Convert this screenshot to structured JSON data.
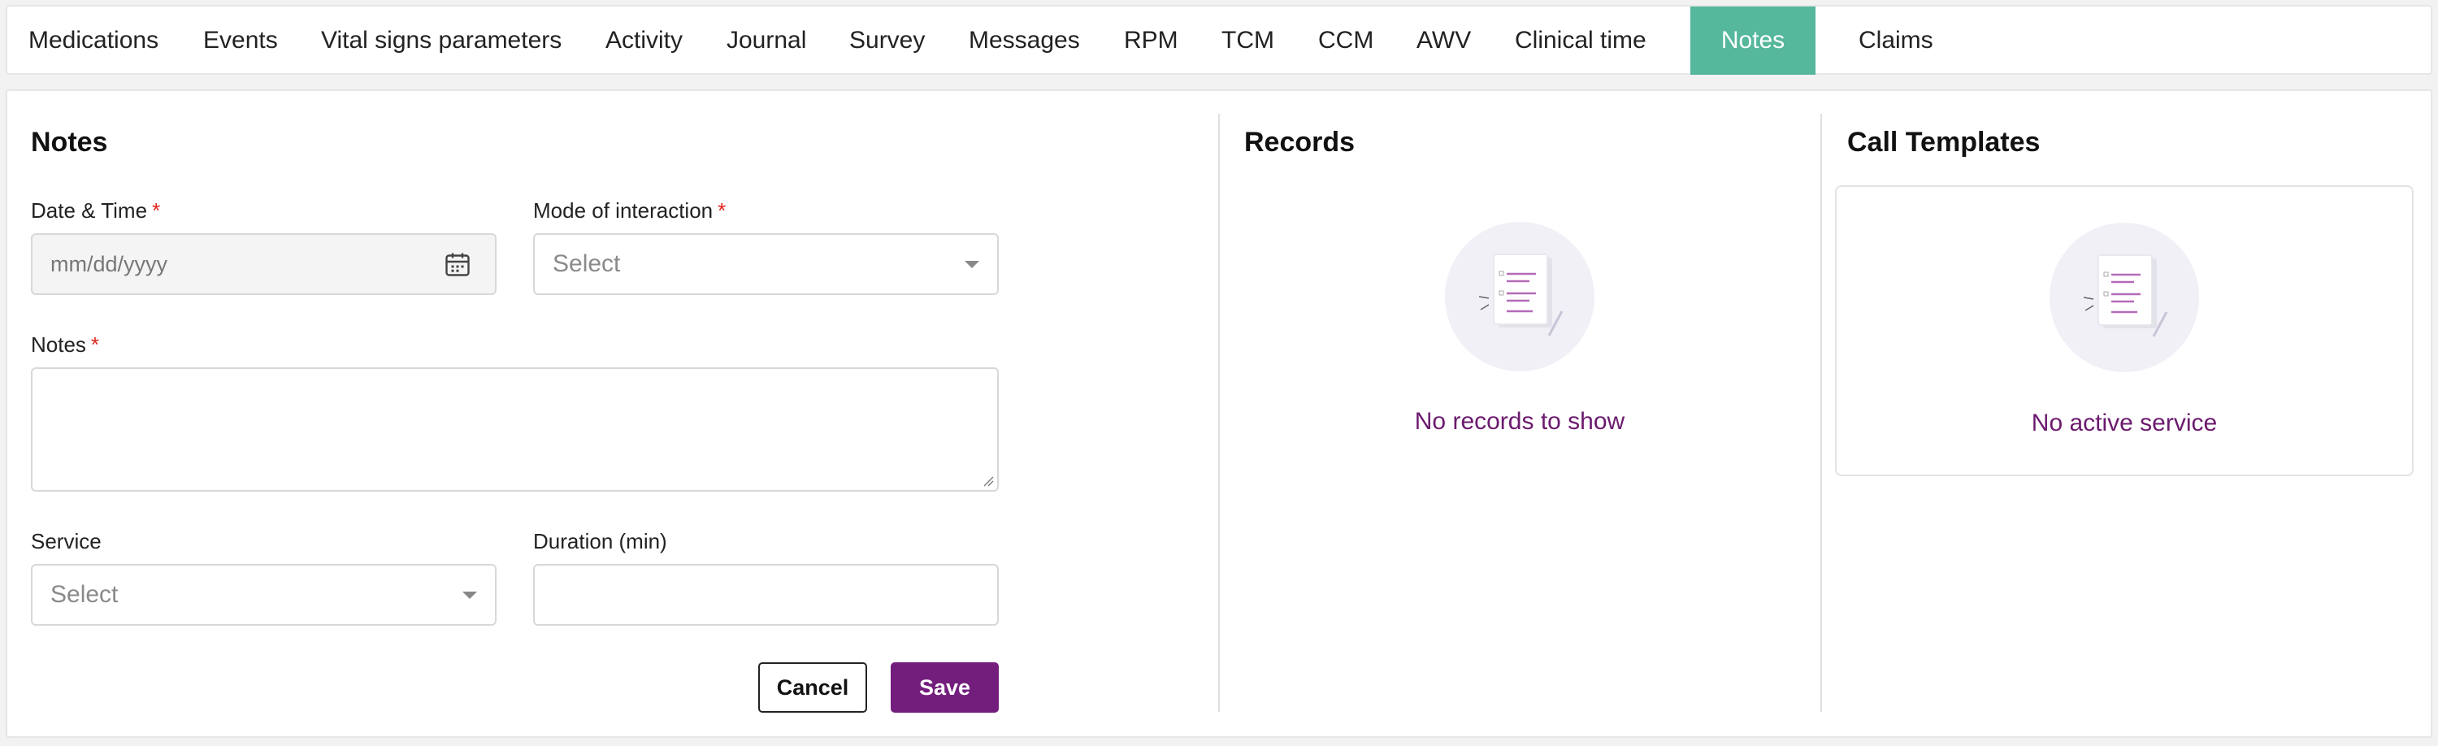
{
  "tabs": [
    {
      "label": "Medications"
    },
    {
      "label": "Events"
    },
    {
      "label": "Vital signs parameters"
    },
    {
      "label": "Activity"
    },
    {
      "label": "Journal"
    },
    {
      "label": "Survey"
    },
    {
      "label": "Messages"
    },
    {
      "label": "RPM"
    },
    {
      "label": "TCM"
    },
    {
      "label": "CCM"
    },
    {
      "label": "AWV"
    },
    {
      "label": "Clinical time"
    },
    {
      "label": "Notes",
      "active": true
    },
    {
      "label": "Claims"
    }
  ],
  "notes_form": {
    "title": "Notes",
    "date_time": {
      "label": "Date & Time",
      "required_mark": "*",
      "placeholder": "mm/dd/yyyy"
    },
    "mode": {
      "label": "Mode of interaction",
      "required_mark": "*",
      "value": "Select"
    },
    "notes": {
      "label": "Notes",
      "required_mark": "*",
      "value": ""
    },
    "service": {
      "label": "Service",
      "value": "Select"
    },
    "duration": {
      "label": "Duration (min)",
      "value": ""
    },
    "cancel_label": "Cancel",
    "save_label": "Save"
  },
  "records": {
    "title": "Records",
    "empty_text": "No records to show"
  },
  "call_templates": {
    "title": "Call Templates",
    "empty_text": "No active service"
  },
  "colors": {
    "active_tab": "#55b79b",
    "primary_button": "#731d7d",
    "empty_text": "#6b1a6e",
    "required": "#e2231a"
  }
}
